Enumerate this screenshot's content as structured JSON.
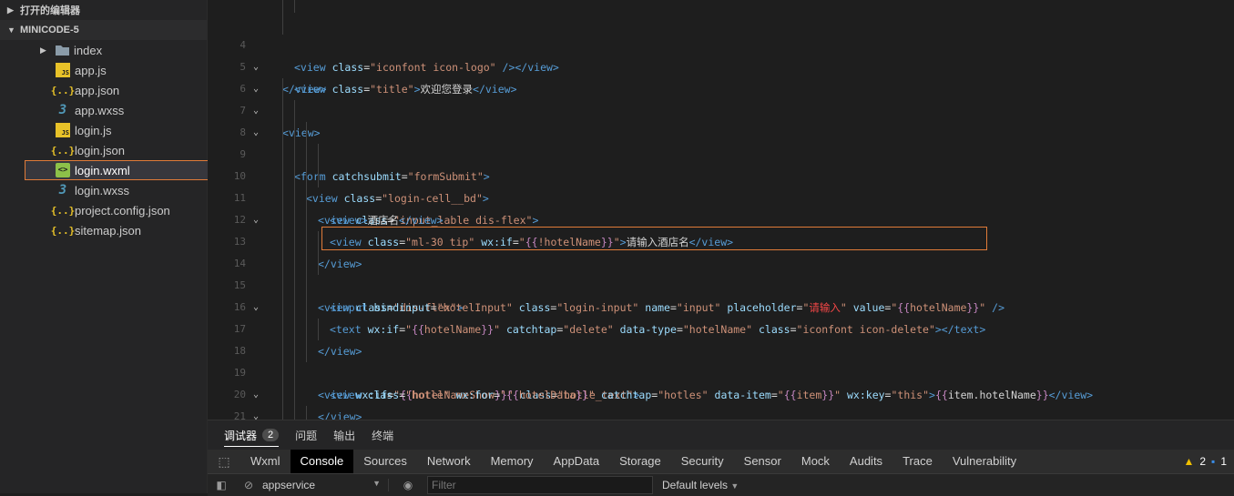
{
  "sidebar": {
    "open_editors_label": "打开的编辑器",
    "project_label": "MINICODE-5",
    "items": [
      {
        "name": "index",
        "type": "folder"
      },
      {
        "name": "app.js",
        "type": "js"
      },
      {
        "name": "app.json",
        "type": "json"
      },
      {
        "name": "app.wxss",
        "type": "css"
      },
      {
        "name": "login.js",
        "type": "js"
      },
      {
        "name": "login.json",
        "type": "json"
      },
      {
        "name": "login.wxml",
        "type": "wxml"
      },
      {
        "name": "login.wxss",
        "type": "css"
      },
      {
        "name": "project.config.json",
        "type": "json"
      },
      {
        "name": "sitemap.json",
        "type": "json"
      }
    ]
  },
  "editor": {
    "line_numbers": [
      "",
      "4",
      "5",
      "6",
      "7",
      "8",
      "9",
      "10",
      "11",
      "12",
      "13",
      "14",
      "15",
      "16",
      "17",
      "18",
      "19",
      "20",
      "21",
      "22"
    ],
    "highlighted_line": "14"
  },
  "bottom_panel": {
    "tabs": [
      {
        "label": "调试器",
        "badge": "2"
      },
      {
        "label": "问题"
      },
      {
        "label": "输出"
      },
      {
        "label": "终端"
      }
    ],
    "devtools_tabs": [
      "Wxml",
      "Console",
      "Sources",
      "Network",
      "Memory",
      "AppData",
      "Storage",
      "Security",
      "Sensor",
      "Mock",
      "Audits",
      "Trace",
      "Vulnerability"
    ],
    "active_devtools_tab": "Console",
    "warnings_count": "2",
    "messages_count": "1",
    "context_value": "appservice",
    "filter_placeholder": "Filter",
    "levels_label": "Default levels"
  },
  "colors": {
    "accent_outline": "#e07b39",
    "editor_bg": "#1e1e1e",
    "sidebar_bg": "#252526"
  }
}
